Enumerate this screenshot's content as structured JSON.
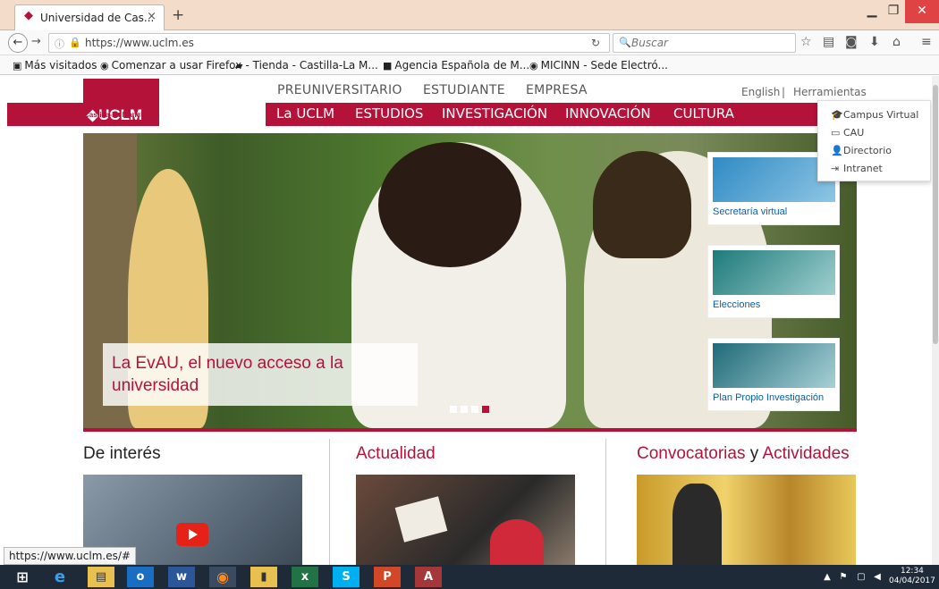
{
  "browser": {
    "tab_title": "Universidad de Cas...",
    "new_tab": "+",
    "url": "https://www.uclm.es",
    "search_placeholder": "Buscar",
    "bookmarks": [
      "Más visitados",
      "Comenzar a usar Firefox",
      "- Tienda - Castilla-La M...",
      "Agencia Española de M...",
      "MICINN - Sede Electró..."
    ]
  },
  "site": {
    "logo_text": "UCLM",
    "logo_sub_1": "Universidad de",
    "logo_sub_2": "Castilla-La Mancha",
    "top_menu": [
      "PREUNIVERSITARIO",
      "ESTUDIANTE",
      "EMPRESA"
    ],
    "main_menu": [
      "La UCLM",
      "ESTUDIOS",
      "INVESTIGACIÓN",
      "INNOVACIÓN",
      "CULTURA"
    ],
    "util_links": [
      "English",
      "|",
      "Herramientas"
    ],
    "tools_menu": [
      "Campus Virtual",
      "CAU",
      "Directorio",
      "Intranet"
    ],
    "hero_caption": "La EvAU, el nuevo acceso a la universidad",
    "tiles": [
      "Secretaría virtual",
      "Elecciones",
      "Plan Propio Investigación"
    ],
    "sections": {
      "interes": "De interés",
      "actualidad": "Actualidad",
      "convocatorias_1": "Convocatorias",
      "convocatorias_2": "y",
      "convocatorias_3": "Actividades"
    },
    "slider_active_index": 3
  },
  "status_url": "https://www.uclm.es/#",
  "taskbar": {
    "time": "12:34",
    "date": "04/04/2017"
  },
  "colors": {
    "brand": "#b5123a",
    "link": "#0a5ea8",
    "taskbar": "#1e2a38"
  }
}
